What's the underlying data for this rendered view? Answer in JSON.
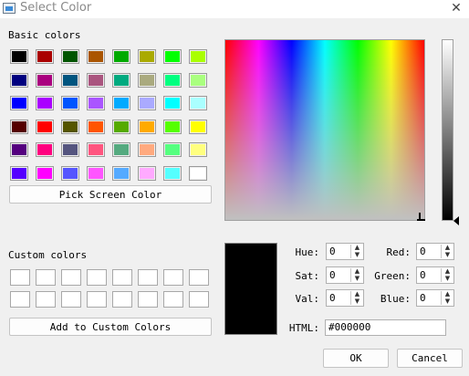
{
  "window": {
    "title": "Select Color",
    "close_glyph": "✕"
  },
  "basic": {
    "label": "Basic colors",
    "colors": [
      [
        "#000000",
        "#aa0000",
        "#005500",
        "#aa5500",
        "#00aa00",
        "#aaaa00",
        "#00ff00",
        "#aaff00"
      ],
      [
        "#00007f",
        "#aa007f",
        "#00557f",
        "#aa557f",
        "#00aa7f",
        "#aaaa7f",
        "#00ff7f",
        "#aaff7f"
      ],
      [
        "#0000ff",
        "#aa00ff",
        "#0055ff",
        "#aa55ff",
        "#00aaff",
        "#aaaaff",
        "#00ffff",
        "#aaffff"
      ],
      [
        "#550000",
        "#ff0000",
        "#555500",
        "#ff5500",
        "#55aa00",
        "#ffaa00",
        "#55ff00",
        "#ffff00"
      ],
      [
        "#55007f",
        "#ff007f",
        "#55557f",
        "#ff557f",
        "#55aa7f",
        "#ffaa7f",
        "#55ff7f",
        "#ffff7f"
      ],
      [
        "#5500ff",
        "#ff00ff",
        "#5555ff",
        "#ff55ff",
        "#55aaff",
        "#ffaaff",
        "#55ffff",
        "#ffffff"
      ]
    ]
  },
  "pick_screen_label": "Pick Screen Color",
  "custom": {
    "label": "Custom colors"
  },
  "add_custom_label": "Add to Custom Colors",
  "fields": {
    "hue": {
      "label": "Hue:",
      "value": "0"
    },
    "sat": {
      "label": "Sat:",
      "value": "0"
    },
    "val": {
      "label": "Val:",
      "value": "0"
    },
    "red": {
      "label": "Red:",
      "value": "0"
    },
    "green": {
      "label": "Green:",
      "value": "0"
    },
    "blue": {
      "label": "Blue:",
      "value": "0"
    },
    "html": {
      "label": "HTML:",
      "value": "#000000"
    }
  },
  "current_color": "#000000",
  "buttons": {
    "ok": "OK",
    "cancel": "Cancel"
  },
  "icons": {
    "spin_up": "▲",
    "spin_down": "▼"
  }
}
